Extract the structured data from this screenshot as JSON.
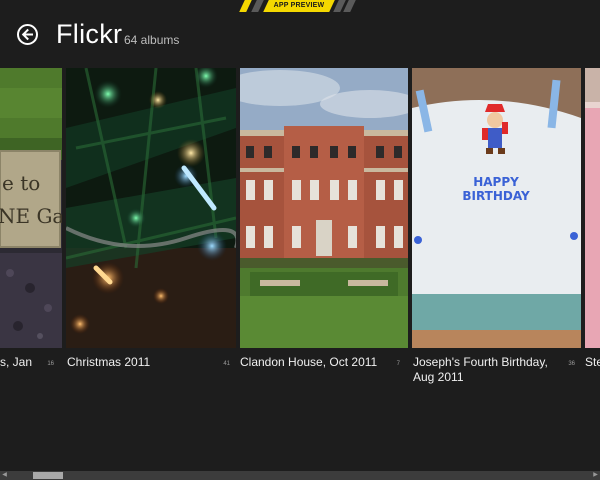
{
  "banner": {
    "label": "APP PREVIEW",
    "color": "#f4d800"
  },
  "header": {
    "title": "Flickr",
    "album_count": "64 albums",
    "back_icon": "back-arrow-icon"
  },
  "albums": [
    {
      "caption": "s, Jan",
      "count": "16",
      "sign_text_1": "e to",
      "sign_text_2": "NE Ga"
    },
    {
      "caption": "Christmas 2011",
      "count": "41"
    },
    {
      "caption": "Clandon House, Oct 2011",
      "count": "7"
    },
    {
      "caption": "Joseph's Fourth Birthday, Aug 2011",
      "count": "36",
      "cake_text_1": "HAPPY",
      "cake_text_2": "BIRTHDAY"
    },
    {
      "caption": "Ste",
      "count": ""
    }
  ],
  "scrollbar": {
    "left_arrow": "◀",
    "right_arrow": "▶"
  }
}
